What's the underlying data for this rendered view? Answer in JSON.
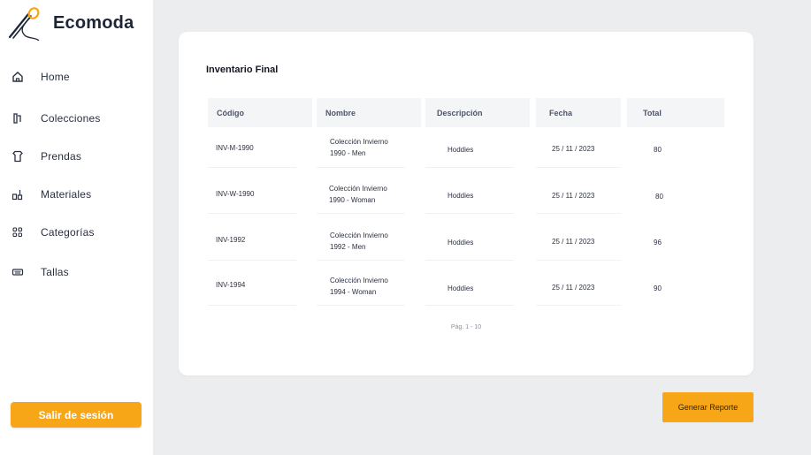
{
  "brand": {
    "name": "Ecomoda",
    "logo_icon": "needle-thread-icon",
    "accent_color": "#f6a616"
  },
  "sidebar": {
    "items": [
      {
        "label": "Home",
        "icon": "home-icon"
      },
      {
        "label": "Colecciones",
        "icon": "collections-icon"
      },
      {
        "label": "Prendas",
        "icon": "shirt-icon"
      },
      {
        "label": "Materiales",
        "icon": "materials-icon"
      },
      {
        "label": "Categorías",
        "icon": "grid-icon"
      },
      {
        "label": "Tallas",
        "icon": "keyboard-icon"
      }
    ],
    "logout_label": "Salir de sesión"
  },
  "report": {
    "title": "Inventario Final",
    "columns": [
      "Código",
      "Nombre",
      "Descripción",
      "Fecha",
      "Total"
    ],
    "rows": [
      {
        "codigo": "INV-M-1990",
        "nombre_1": "Colección Invierno",
        "nombre_2": "1990 - Men",
        "descripcion": "Hoddies",
        "fecha": "25 / 11 / 2023",
        "total": "80"
      },
      {
        "codigo": "INV-W-1990",
        "nombre_1": "Colección Invierno",
        "nombre_2": "1990 - Woman",
        "descripcion": "Hoddies",
        "fecha": "25 / 11 / 2023",
        "total": "80"
      },
      {
        "codigo": "INV-1992",
        "nombre_1": "Colección Invierno",
        "nombre_2": "1992 - Men",
        "descripcion": "Hoddies",
        "fecha": "25 / 11 / 2023",
        "total": "96"
      },
      {
        "codigo": "INV-1994",
        "nombre_1": "Colección Invierno",
        "nombre_2": "1994 - Woman",
        "descripcion": "Hoddies",
        "fecha": "25 / 11 / 2023",
        "total": "90"
      }
    ],
    "pagination": "Pág. 1 - 10",
    "generate_label": "Generar Reporte"
  }
}
